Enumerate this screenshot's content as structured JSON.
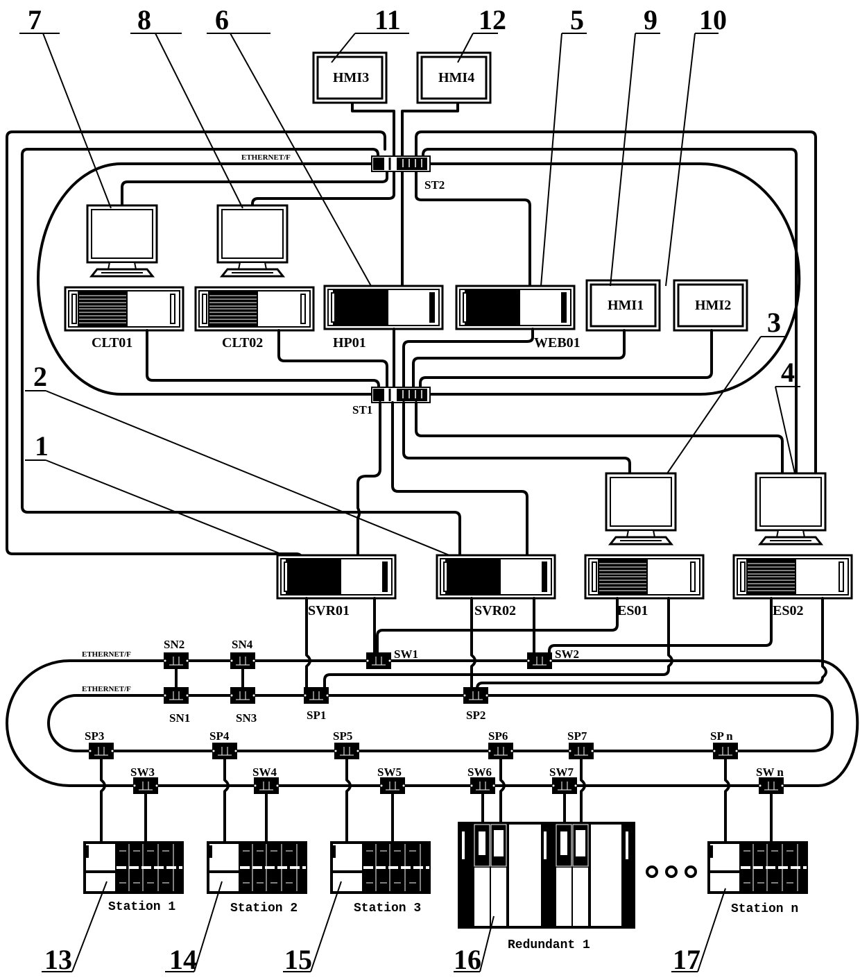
{
  "diagram": {
    "title": "",
    "reference_numbers": {
      "svr01": "1",
      "svr02": "2",
      "es01": "3",
      "es02": "4",
      "web01": "5",
      "hp01": "6",
      "clt01": "7",
      "clt02": "8",
      "hmi1": "9",
      "hmi2": "10",
      "hmi3": "11",
      "hmi4": "12",
      "station1": "13",
      "station2": "14",
      "station3": "15",
      "redundant1": "16",
      "station_n": "17"
    },
    "upper_network": {
      "label": "ETHERNET/F",
      "switch_top": "ST2",
      "switch_bottom": "ST1"
    },
    "devices": {
      "clt01": "CLT01",
      "clt02": "CLT02",
      "hp01": "HP01",
      "web01": "WEB01",
      "hmi1": "HMI1",
      "hmi2": "HMI2",
      "hmi3": "HMI3",
      "hmi4": "HMI4",
      "svr01": "SVR01",
      "svr02": "SVR02",
      "es01": "ES01",
      "es02": "ES02"
    },
    "lower_network": {
      "label_top": "ETHERNET/F",
      "label_bottom": "ETHERNET/F",
      "switches": {
        "sn1": "SN1",
        "sn2": "SN2",
        "sn3": "SN3",
        "sn4": "SN4",
        "sw1": "SW1",
        "sw2": "SW2",
        "sp1": "SP1",
        "sp2": "SP2",
        "sp3": "SP3",
        "sp4": "SP4",
        "sp5": "SP5",
        "sp6": "SP6",
        "sp7": "SP7",
        "spn": "SP n",
        "sw3": "SW3",
        "sw4": "SW4",
        "sw5": "SW5",
        "sw6": "SW6",
        "sw7": "SW7",
        "swn": "SW n"
      }
    },
    "stations": {
      "station1": "Station 1",
      "station2": "Station 2",
      "station3": "Station 3",
      "redundant1": "Redundant 1",
      "station_n": "Station n",
      "ellipsis": "ooo"
    }
  }
}
